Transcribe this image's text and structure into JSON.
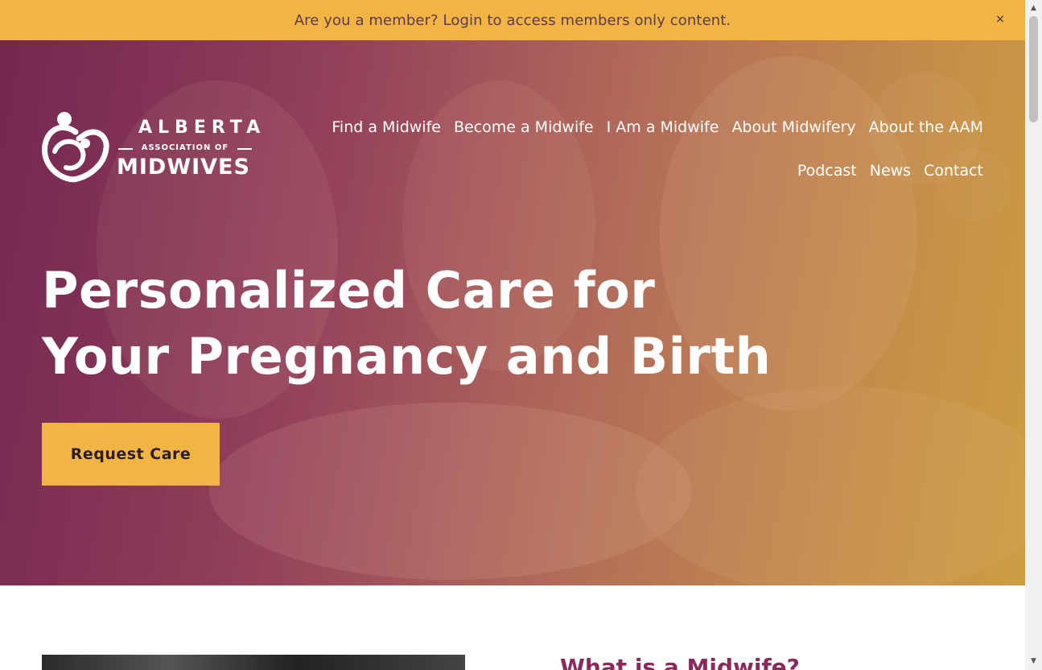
{
  "announcement": {
    "text": "Are you a member? Login to access members only content.",
    "close_label": "×"
  },
  "logo": {
    "line1": "ALBERTA",
    "line2": "ASSOCIATION OF",
    "line3": "MIDWIVES"
  },
  "nav": {
    "items": [
      "Find a Midwife",
      "Become a Midwife",
      "I Am a Midwife",
      "About Midwifery",
      "About the AAM",
      "Podcast",
      "News",
      "Contact"
    ]
  },
  "hero": {
    "headline_line1": "Personalized Care for",
    "headline_line2": "Your Pregnancy and Birth",
    "cta_label": "Request Care"
  },
  "section": {
    "heading": "What is a Midwife?"
  },
  "scrollbar": {
    "up_icon": "▲",
    "down_icon": "▼"
  },
  "colors": {
    "accent": "#f2b544",
    "brand_purple": "#8a2a5b"
  }
}
